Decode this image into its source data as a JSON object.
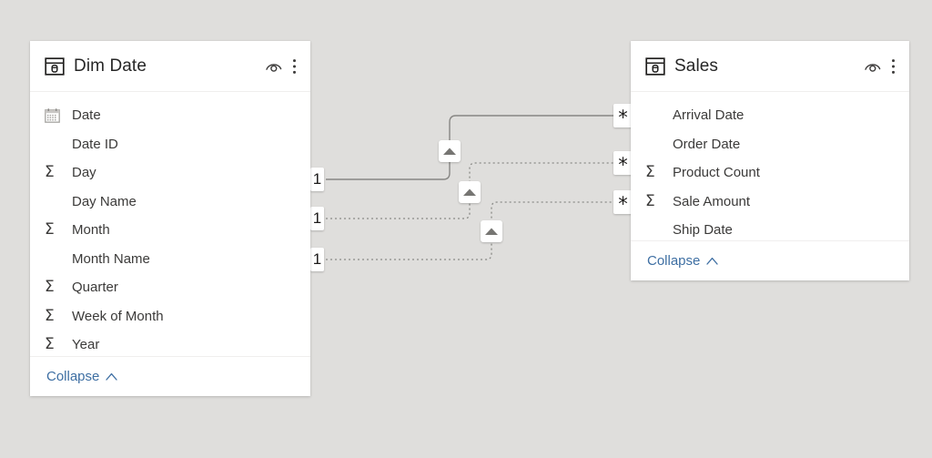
{
  "canvas": {
    "background_color": "#dfdedc",
    "view_name": "model-relationship-view"
  },
  "tables": [
    {
      "id": "dim-date",
      "name": "Dim Date",
      "header_icon": "table-icon",
      "actions": [
        {
          "name": "hide-icon",
          "label": "eye-icon"
        },
        {
          "name": "more-options-icon",
          "label": "kebab-icon"
        }
      ],
      "fields": [
        {
          "label": "Date",
          "icon": "calendar-icon"
        },
        {
          "label": "Date ID",
          "icon": "none"
        },
        {
          "label": "Day",
          "icon": "sigma-icon",
          "glyph": "Σ"
        },
        {
          "label": "Day Name",
          "icon": "none"
        },
        {
          "label": "Month",
          "icon": "sigma-icon",
          "glyph": "Σ"
        },
        {
          "label": "Month Name",
          "icon": "none"
        },
        {
          "label": "Quarter",
          "icon": "sigma-icon",
          "glyph": "Σ"
        },
        {
          "label": "Week of Month",
          "icon": "sigma-icon",
          "glyph": "Σ"
        },
        {
          "label": "Year",
          "icon": "sigma-icon",
          "glyph": "Σ"
        }
      ],
      "footer": {
        "label": "Collapse",
        "icon": "chevron-up-icon"
      }
    },
    {
      "id": "sales",
      "name": "Sales",
      "header_icon": "table-icon",
      "actions": [
        {
          "name": "hide-icon",
          "label": "eye-icon"
        },
        {
          "name": "more-options-icon",
          "label": "kebab-icon"
        }
      ],
      "fields": [
        {
          "label": "Arrival Date",
          "icon": "none"
        },
        {
          "label": "Order Date",
          "icon": "none"
        },
        {
          "label": "Product Count",
          "icon": "sigma-icon",
          "glyph": "Σ"
        },
        {
          "label": "Sale Amount",
          "icon": "sigma-icon",
          "glyph": "Σ"
        },
        {
          "label": "Ship Date",
          "icon": "none"
        }
      ],
      "footer": {
        "label": "Collapse",
        "icon": "chevron-up-icon"
      }
    }
  ],
  "relationships": [
    {
      "id": "rel-active-arrival-date",
      "from_table": "Dim Date",
      "to_table": "Sales",
      "from_cardinality": "1",
      "to_cardinality": "*",
      "state": "active",
      "line_style": "solid",
      "cross_filter_direction": "single",
      "direction_marker": "arrow-up-icon"
    },
    {
      "id": "rel-inactive-order-date",
      "from_table": "Dim Date",
      "to_table": "Sales",
      "from_cardinality": "1",
      "to_cardinality": "*",
      "state": "inactive",
      "line_style": "dotted",
      "cross_filter_direction": "single",
      "direction_marker": "arrow-up-icon"
    },
    {
      "id": "rel-inactive-ship-date",
      "from_table": "Dim Date",
      "to_table": "Sales",
      "from_cardinality": "1",
      "to_cardinality": "*",
      "state": "inactive",
      "line_style": "dotted",
      "cross_filter_direction": "single",
      "direction_marker": "arrow-up-icon"
    }
  ],
  "colors": {
    "canvas": "#dfdedc",
    "card": "#ffffff",
    "link": "#3e6fa3",
    "text": "#3b3a39",
    "title": "#262626",
    "line_active": "#878683",
    "line_inactive": "#8a8a87"
  }
}
